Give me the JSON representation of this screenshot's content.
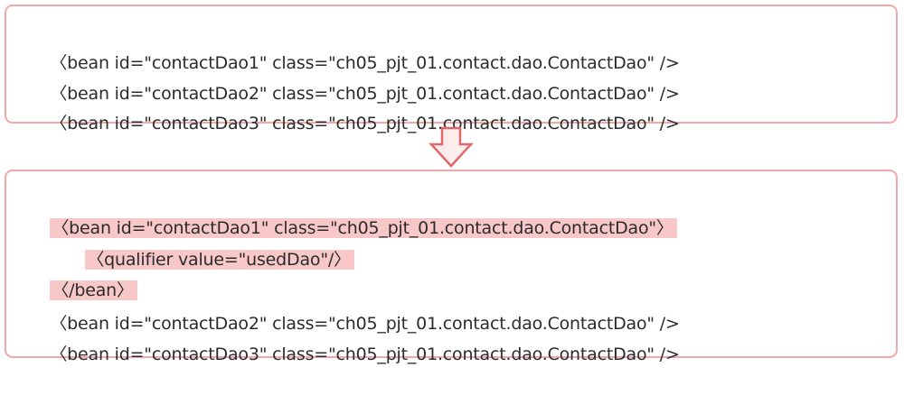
{
  "before": {
    "lines": [
      "〈bean id=\"contactDao1\" class=\"ch05_pjt_01.contact.dao.ContactDao\" />",
      "〈bean id=\"contactDao2\" class=\"ch05_pjt_01.contact.dao.ContactDao\" />",
      "〈bean id=\"contactDao3\" class=\"ch05_pjt_01.contact.dao.ContactDao\" />"
    ]
  },
  "after": {
    "lines": [
      "〈bean id=\"contactDao1\" class=\"ch05_pjt_01.contact.dao.ContactDao\"〉",
      "〈qualifier value=\"usedDao\"/〉",
      "〈/bean〉",
      "〈bean id=\"contactDao2\" class=\"ch05_pjt_01.contact.dao.ContactDao\" />",
      "〈bean id=\"contactDao3\" class=\"ch05_pjt_01.contact.dao.ContactDao\" />"
    ]
  },
  "colors": {
    "border": "#f4a7a9",
    "highlight": "#f7c8c7",
    "arrow_stroke": "#e0676a",
    "text": "#2b2b2b"
  },
  "icons": {
    "transition": "down-arrow-icon"
  }
}
